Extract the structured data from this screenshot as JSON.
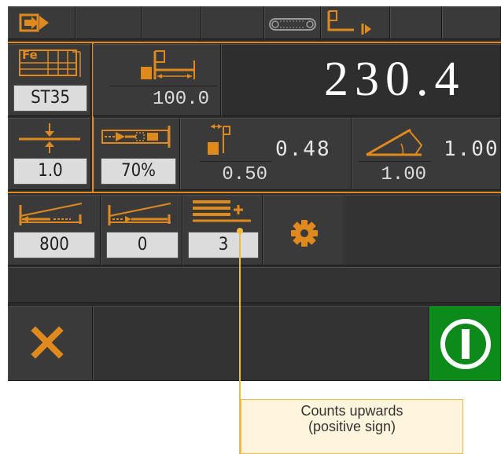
{
  "colors": {
    "accent": "#e08a1e",
    "panel": "#3a3a3a",
    "background": "#2b2b2b",
    "start": "#0c8a1a",
    "value_box": "#dcdcdc"
  },
  "top_bar": {
    "icons": [
      "import-program-icon",
      "conveyor-icon",
      "backgauge-retract-icon"
    ]
  },
  "material": {
    "label": "Fe",
    "value": "ST35",
    "icon": "material-table-icon"
  },
  "length": {
    "value": "100.0",
    "icon": "part-length-icon"
  },
  "backgauge": {
    "value": "230.4"
  },
  "row2": {
    "thickness": {
      "value": "1.0",
      "icon": "sheet-thickness-icon"
    },
    "speed": {
      "value": "70%",
      "icon": "cut-speed-icon"
    },
    "gap": {
      "value": "0.50",
      "computed": "0.48",
      "icon": "blade-gap-icon"
    },
    "angle": {
      "value": "1.00",
      "computed": "1.00",
      "icon": "cut-angle-icon"
    }
  },
  "row3": {
    "retract": {
      "value": "800",
      "icon": "retract-distance-icon"
    },
    "offset": {
      "value": "0",
      "icon": "offset-icon"
    },
    "counter": {
      "value": "3",
      "icon": "counter-up-icon"
    },
    "settings": {
      "icon": "gear-icon"
    }
  },
  "bottom": {
    "cancel_icon": "close-icon",
    "start_icon": "start-icon"
  },
  "callout": {
    "line1": "Counts upwards",
    "line2": "(positive sign)"
  }
}
